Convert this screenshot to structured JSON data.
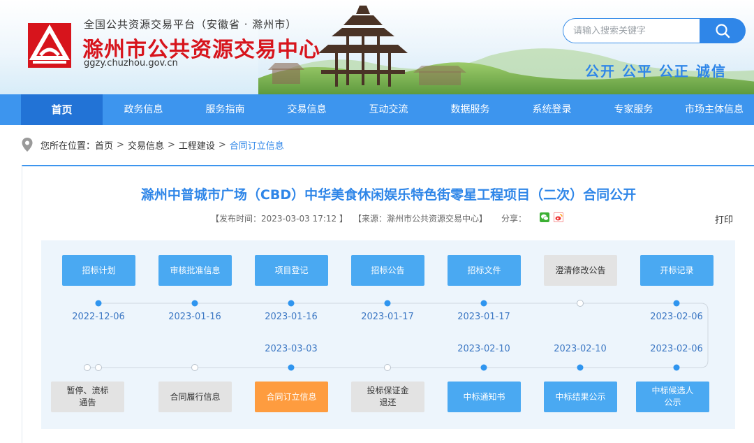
{
  "header": {
    "platform": "全国公共资源交易平台（安徽省 · 滁州市）",
    "site_name": "滁州市公共资源交易中心",
    "domain": "ggzy.chuzhou.gov.cn",
    "search_placeholder": "请输入搜索关键字",
    "motto": "公开 公平 公正 诚信",
    "logo_icon": "chuzhou-logo-icon",
    "brand_red": "#d7141c",
    "accent_blue": "#2f86e8"
  },
  "nav": {
    "items": [
      "首页",
      "政务信息",
      "服务指南",
      "交易信息",
      "互动交流",
      "数据服务",
      "系统登录",
      "专家服务",
      "市场主体信息"
    ],
    "active_index": 0
  },
  "breadcrumb": {
    "prefix": "您所在位置：",
    "items": [
      "首页",
      "交易信息",
      "工程建设",
      "合同订立信息"
    ],
    "separator": ">"
  },
  "article": {
    "title": "滁州中普城市广场（CBD）中华美食休闲娱乐特色街零星工程项目（二次）合同公开",
    "publish": "【发布时间：2023-03-03 17:12 】",
    "source": "【来源：滁州市公共资源交易中心】",
    "share_label": "分享：",
    "share_icons": [
      "wechat-icon",
      "weibo-icon"
    ],
    "print": "打印"
  },
  "flow": {
    "top": [
      {
        "label": "招标计划",
        "date": "2022-12-06",
        "state": "blue"
      },
      {
        "label": "审核批准信息",
        "date": "2023-01-16",
        "state": "blue"
      },
      {
        "label": "项目登记",
        "date": "2023-01-16",
        "state": "blue"
      },
      {
        "label": "招标公告",
        "date": "2023-01-17",
        "state": "blue"
      },
      {
        "label": "招标文件",
        "date": "2023-01-17",
        "state": "blue"
      },
      {
        "label": "澄清修改公告",
        "date": "",
        "state": "gray"
      },
      {
        "label": "开标记录",
        "date": "2023-02-06",
        "state": "blue"
      }
    ],
    "bottom": [
      {
        "label": "暂停、流标\n通告",
        "date": "",
        "state": "gray"
      },
      {
        "label": "合同履行信息",
        "date": "",
        "state": "gray"
      },
      {
        "label": "合同订立信息",
        "date": "2023-03-03",
        "state": "orange"
      },
      {
        "label": "投标保证金\n退还",
        "date": "",
        "state": "gray"
      },
      {
        "label": "中标通知书",
        "date": "2023-02-10",
        "state": "blue"
      },
      {
        "label": "中标结果公示",
        "date": "2023-02-10",
        "state": "blue"
      },
      {
        "label": "中标候选人\n公示",
        "date": "2023-02-06",
        "state": "blue"
      }
    ]
  }
}
